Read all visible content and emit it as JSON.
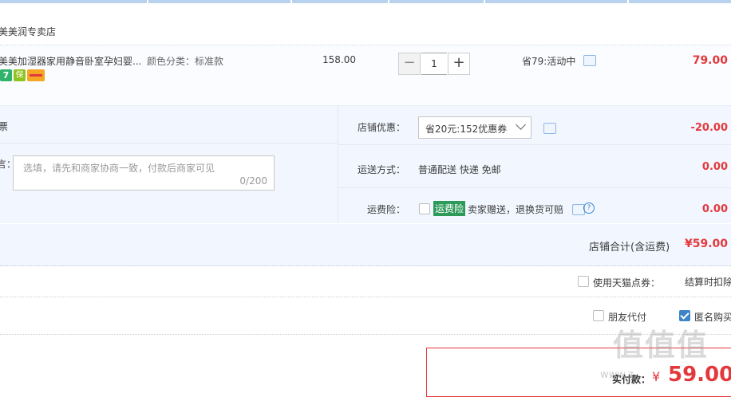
{
  "shop": {
    "name": "美美润专卖店"
  },
  "item": {
    "title": "美美加湿器家用静音卧室孕妇婴...",
    "spec": "颜色分类：标准款",
    "price": "158.00",
    "quantity": "1",
    "minus_label": "−",
    "plus_label": "+",
    "promo": "省79:活动中",
    "total": "79.00",
    "badges": [
      "7",
      "保",
      "卡"
    ]
  },
  "invoice": {
    "label": "票"
  },
  "message": {
    "label": "言：",
    "placeholder": "选填，请先和商家协商一致，付款后商家可见",
    "count": "0/200"
  },
  "shop_coupon": {
    "label": "店铺优惠：",
    "selected": "省20元:152优惠券",
    "amount": "-20.00"
  },
  "shipping": {
    "label": "运送方式：",
    "value": "普通配送 快递 免邮",
    "amount": "0.00"
  },
  "insurance": {
    "label": "运费险：",
    "tag": "运费险",
    "text": "卖家赠送，退换货可赔",
    "amount": "0.00"
  },
  "subtotal": {
    "label": "店铺合计(含运费)",
    "value": "¥59.00"
  },
  "tmall_points": {
    "label": "使用天猫点券：",
    "note": "结算时扣除"
  },
  "options": {
    "friend_pay": "朋友代付",
    "anonymous": "匿名购买"
  },
  "payment": {
    "label": "实付款：",
    "currency": "¥",
    "amount": "59.00"
  },
  "watermark": {
    "text": "值值值",
    "url": "www.z..."
  },
  "colors": {
    "accent": "#e4393c",
    "panel": "#f2f7ff",
    "link": "#3d85c6"
  }
}
